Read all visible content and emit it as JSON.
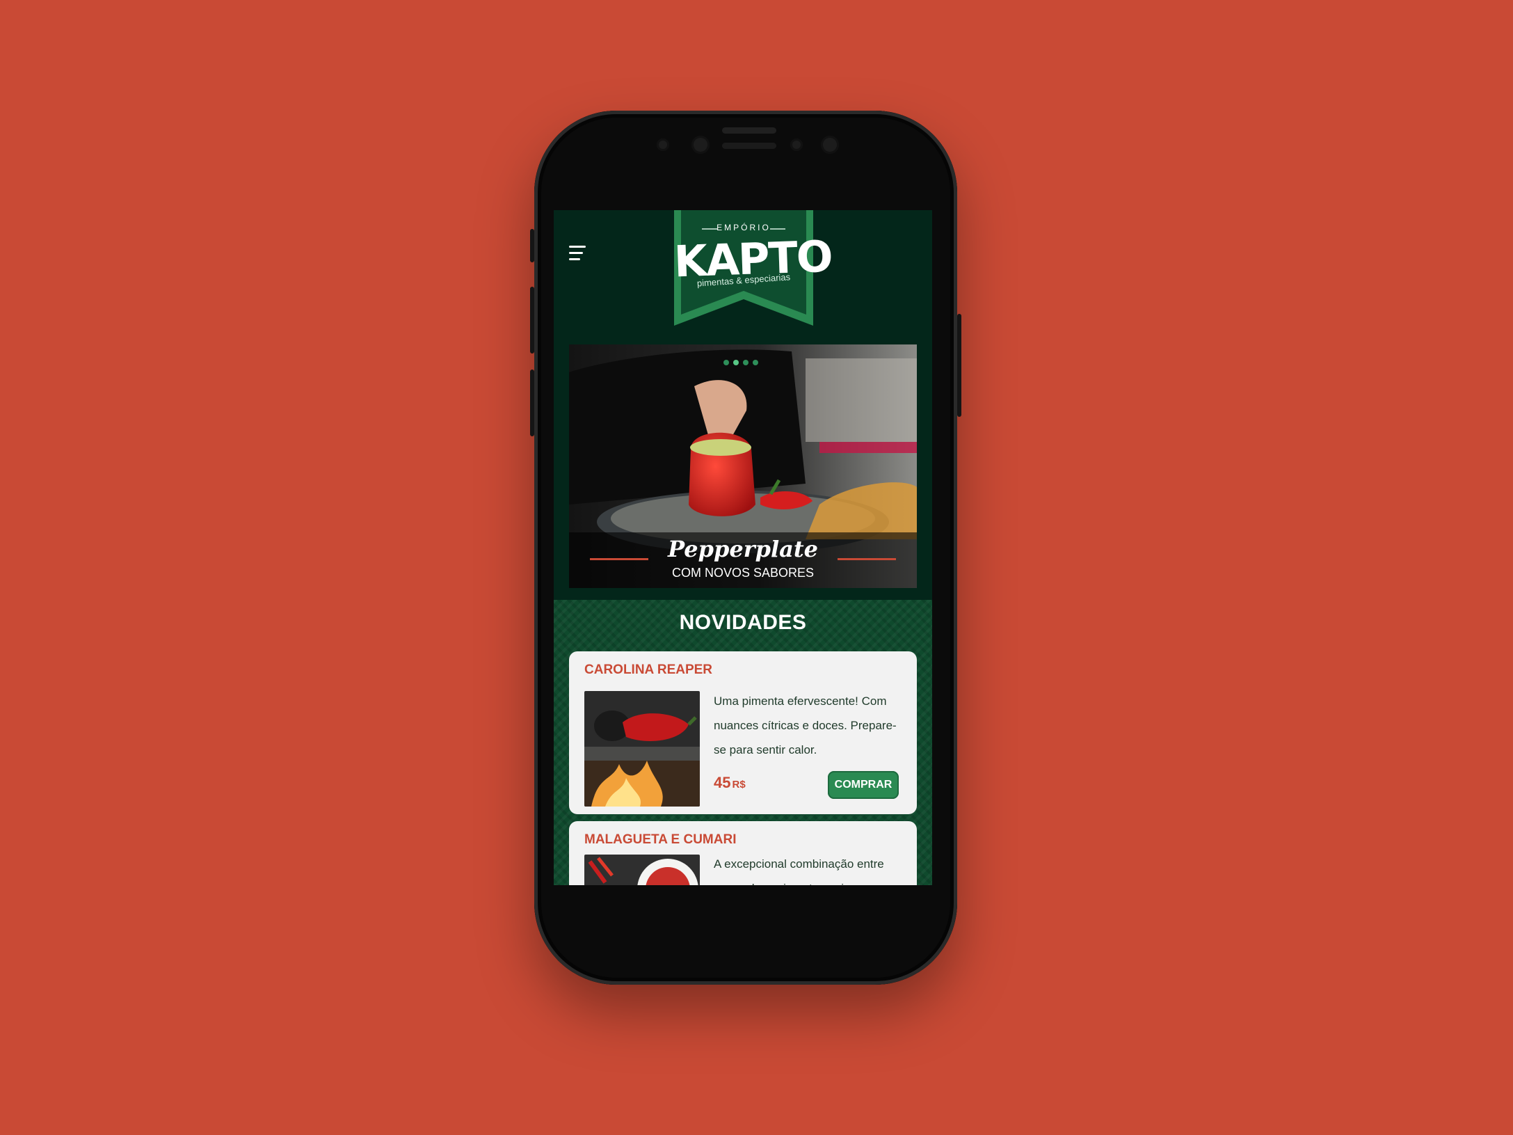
{
  "header": {
    "logo_top": "EMPÓRIO",
    "logo_main": "KAPTO",
    "logo_sub": "pimentas & especiarias"
  },
  "hero": {
    "title": "Pepperplate",
    "subtitle": "COM NOVOS SABORES",
    "slide_count": 4,
    "active_slide": 2
  },
  "news": {
    "title": "NOVIDADES",
    "items": [
      {
        "name": "CAROLINA REAPER",
        "description": "Uma pimenta efervescente! Com nuances cítricas e doces. Prepare-se para sentir calor.",
        "price": "45",
        "currency": "R$",
        "button_label": "COMPRAR"
      },
      {
        "name": "MALAGUETA E CUMARI",
        "description": "A excepcional combinação entre essas duas pimentas, cria uma"
      }
    ]
  },
  "colors": {
    "background": "#c94a35",
    "screen_bg": "#03261a",
    "accent_green": "#2a8a52",
    "accent_red": "#c94a35",
    "card_bg": "#f2f2f2"
  },
  "icons": [
    "menu-icon",
    "carousel-dot"
  ]
}
